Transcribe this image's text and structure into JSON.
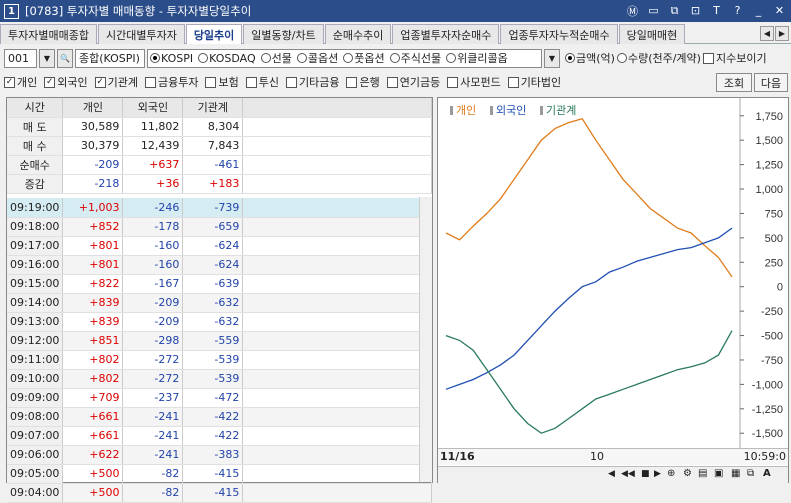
{
  "window": {
    "number": "1",
    "title": "[0783] 투자자별 매매동향 - 투자자별당일추이",
    "controls": [
      "m-icon",
      "window-icon",
      "copy-icon",
      "lock-icon",
      "text-icon",
      "help-icon",
      "minimize-icon",
      "close-icon"
    ]
  },
  "tabs": [
    "투자자별매매종합",
    "시간대별투자자",
    "당일추이",
    "일별동향/차트",
    "순매수추이",
    "업종별투자자순매수",
    "업종투자자누적순매수",
    "당일매매현"
  ],
  "active_tab": 2,
  "toolbar": {
    "code": "001",
    "market": "종합(KOSPI)",
    "market_options": [
      "KOSPI",
      "KOSDAQ",
      "선물",
      "콜옵션",
      "풋옵션",
      "주식선물",
      "위클리콜옵"
    ],
    "selected_market": "KOSPI",
    "unit_options": [
      "금액(억)",
      "수량(천주/계약)"
    ],
    "selected_unit": "금액(억)",
    "index_label": "지수보이기"
  },
  "investors": [
    {
      "label": "개인",
      "checked": true
    },
    {
      "label": "외국인",
      "checked": true
    },
    {
      "label": "기관계",
      "checked": true
    },
    {
      "label": "금융투자",
      "checked": false
    },
    {
      "label": "보험",
      "checked": false
    },
    {
      "label": "투신",
      "checked": false
    },
    {
      "label": "기타금융",
      "checked": false
    },
    {
      "label": "은행",
      "checked": false
    },
    {
      "label": "연기금등",
      "checked": false
    },
    {
      "label": "사모펀드",
      "checked": false
    },
    {
      "label": "기타법인",
      "checked": false
    }
  ],
  "buttons": {
    "query": "조회",
    "next": "다음"
  },
  "summary": {
    "headers": [
      "시간",
      "개인",
      "외국인",
      "기관계"
    ],
    "rows": [
      {
        "label": "매 도",
        "v": [
          "30,589",
          "11,802",
          "8,304"
        ]
      },
      {
        "label": "매 수",
        "v": [
          "30,379",
          "12,439",
          "7,843"
        ]
      },
      {
        "label": "순매수",
        "v": [
          "-209",
          "+637",
          "-461"
        ]
      },
      {
        "label": "증감",
        "v": [
          "-218",
          "+36",
          "+183"
        ]
      }
    ]
  },
  "timeseries": [
    {
      "time": "09:19:00",
      "v": [
        "+1,003",
        "-246",
        "-739"
      ]
    },
    {
      "time": "09:18:00",
      "v": [
        "+852",
        "-178",
        "-659"
      ]
    },
    {
      "time": "09:17:00",
      "v": [
        "+801",
        "-160",
        "-624"
      ]
    },
    {
      "time": "09:16:00",
      "v": [
        "+801",
        "-160",
        "-624"
      ]
    },
    {
      "time": "09:15:00",
      "v": [
        "+822",
        "-167",
        "-639"
      ]
    },
    {
      "time": "09:14:00",
      "v": [
        "+839",
        "-209",
        "-632"
      ]
    },
    {
      "time": "09:13:00",
      "v": [
        "+839",
        "-209",
        "-632"
      ]
    },
    {
      "time": "09:12:00",
      "v": [
        "+851",
        "-298",
        "-559"
      ]
    },
    {
      "time": "09:11:00",
      "v": [
        "+802",
        "-272",
        "-539"
      ]
    },
    {
      "time": "09:10:00",
      "v": [
        "+802",
        "-272",
        "-539"
      ]
    },
    {
      "time": "09:09:00",
      "v": [
        "+709",
        "-237",
        "-472"
      ]
    },
    {
      "time": "09:08:00",
      "v": [
        "+661",
        "-241",
        "-422"
      ]
    },
    {
      "time": "09:07:00",
      "v": [
        "+661",
        "-241",
        "-422"
      ]
    },
    {
      "time": "09:06:00",
      "v": [
        "+622",
        "-241",
        "-383"
      ]
    },
    {
      "time": "09:05:00",
      "v": [
        "+500",
        "-82",
        "-415"
      ]
    },
    {
      "time": "09:04:00",
      "v": [
        "+500",
        "-82",
        "-415"
      ]
    }
  ],
  "chart_data": {
    "type": "line",
    "legend": [
      "개인",
      "외국인",
      "기관계"
    ],
    "colors": {
      "개인": "#e07b1a",
      "외국인": "#1f4fb3",
      "기관계": "#2a7a5a"
    },
    "y_ticks": [
      1750,
      1500,
      1250,
      1000,
      750,
      500,
      250,
      0,
      -250,
      -500,
      -750,
      -1000,
      -1250,
      -1500
    ],
    "ylim": [
      -1600,
      1850
    ],
    "x_start_label": "11/16",
    "x_mid_label": "10",
    "time_readout": "10:59:0",
    "series": [
      {
        "name": "개인",
        "values": [
          550,
          480,
          620,
          750,
          900,
          1100,
          1300,
          1500,
          1620,
          1680,
          1720,
          1500,
          1300,
          1100,
          950,
          800,
          700,
          600,
          550,
          420,
          300,
          100
        ]
      },
      {
        "name": "외국인",
        "values": [
          -1050,
          -1000,
          -950,
          -880,
          -800,
          -700,
          -550,
          -400,
          -250,
          -120,
          0,
          50,
          150,
          200,
          260,
          300,
          340,
          380,
          400,
          450,
          500,
          600
        ]
      },
      {
        "name": "기관계",
        "values": [
          -500,
          -550,
          -650,
          -850,
          -1050,
          -1250,
          -1400,
          -1500,
          -1450,
          -1350,
          -1250,
          -1150,
          -1100,
          -1050,
          -1000,
          -950,
          -900,
          -850,
          -820,
          -780,
          -700,
          -450
        ]
      }
    ]
  }
}
